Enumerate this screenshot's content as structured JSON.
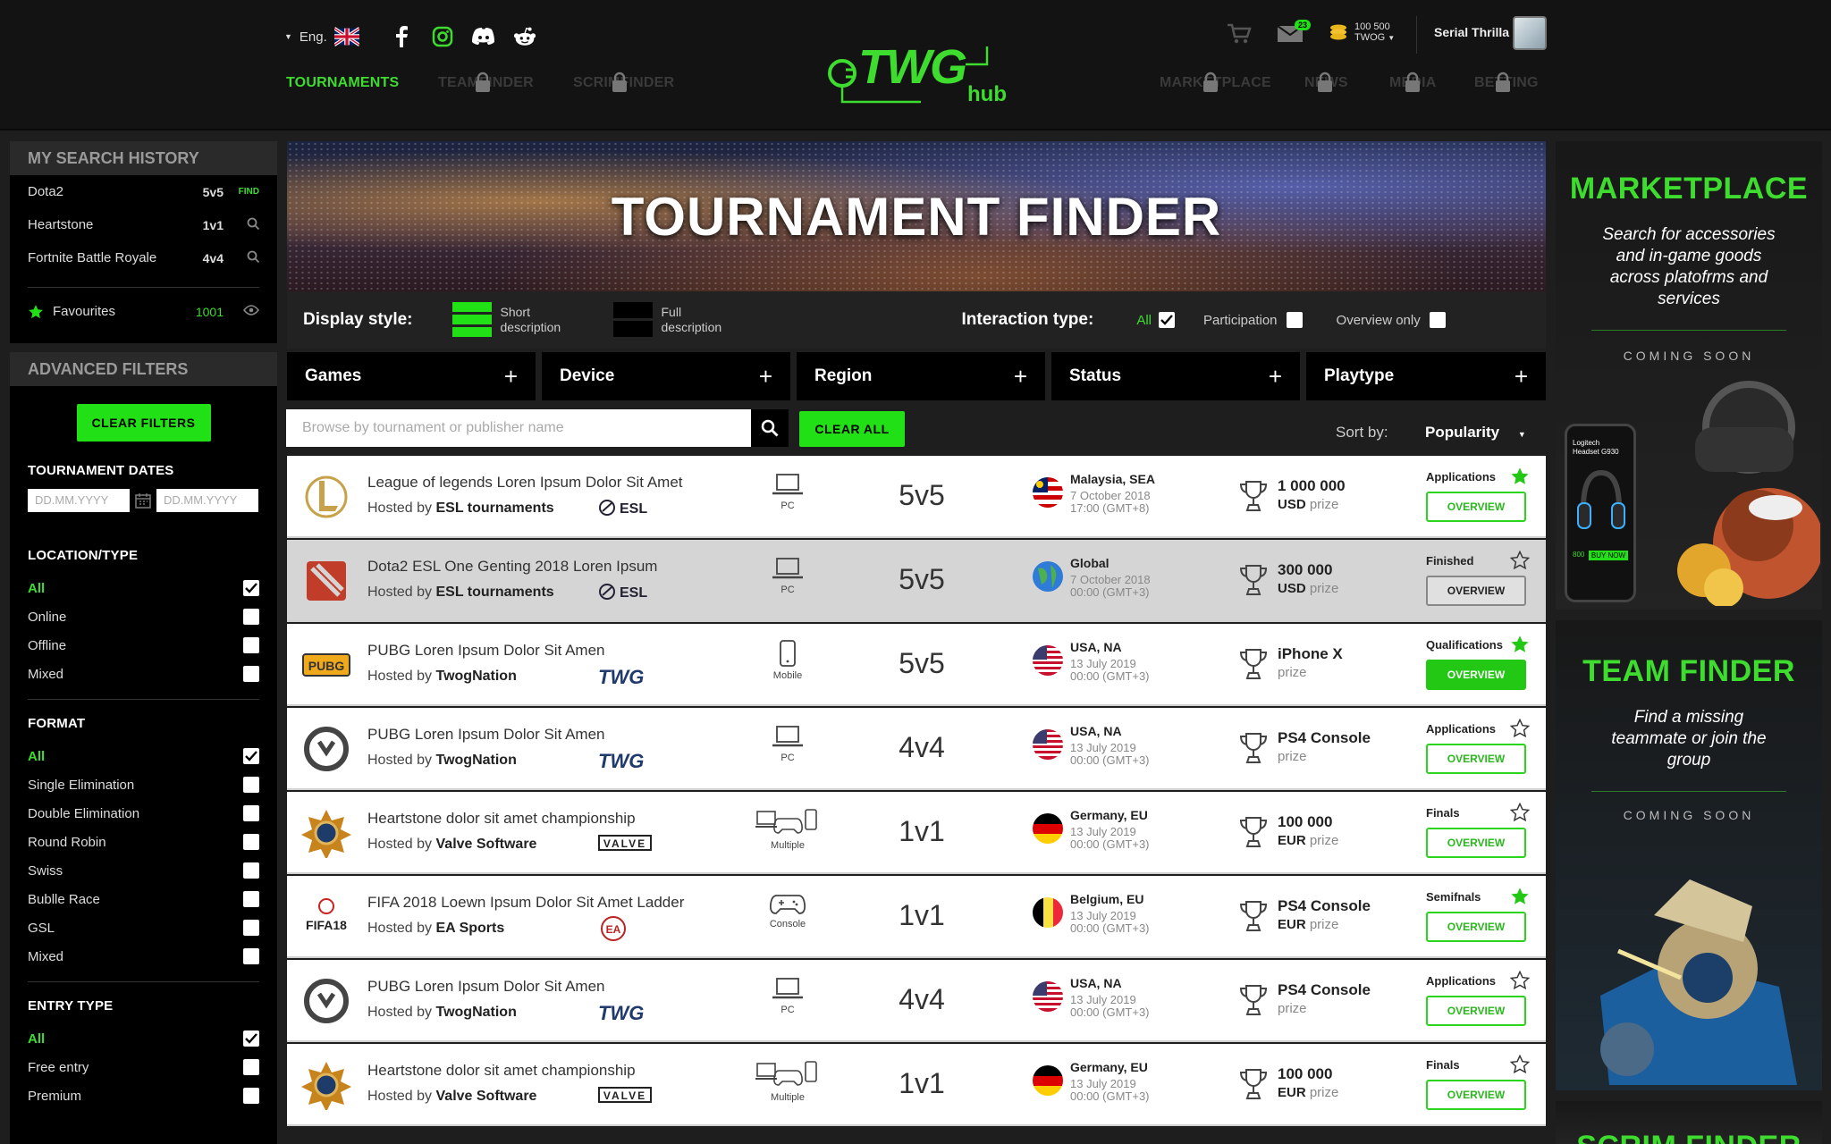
{
  "header": {
    "lang": "Eng.",
    "nav_left": [
      "TOURNAMENTS",
      "TEAMFINDER",
      "SCRIMFINDER"
    ],
    "nav_right": [
      "MARKETPLACE",
      "NEWS",
      "MEDIA",
      "BETTING"
    ],
    "logo_main": "TWG",
    "logo_sub": "hub",
    "msg_count": "23",
    "coins_amount": "100 500",
    "coins_unit": "TWOG",
    "username": "Serial Thrilla"
  },
  "history": {
    "title": "MY SEARCH HISTORY",
    "items": [
      {
        "name": "Dota2",
        "type": "5v5",
        "action": "FIND"
      },
      {
        "name": "Heartstone",
        "type": "1v1"
      },
      {
        "name": "Fortnite Battle Royale",
        "type": "4v4"
      }
    ],
    "fav_label": "Favourites",
    "fav_count": "1001"
  },
  "filters": {
    "title": "ADVANCED FILTERS",
    "clear": "CLEAR FILTERS",
    "dates_title": "TOURNAMENT DATES",
    "date_ph": "DD.MM.YYYY",
    "loc_title": "LOCATION/TYPE",
    "loc": [
      "All",
      "Online",
      "Offline",
      "Mixed"
    ],
    "format_title": "FORMAT",
    "format": [
      "All",
      "Single Elimination",
      "Double Elimination",
      "Round Robin",
      "Swiss",
      "Bublle Race",
      "GSL",
      "Mixed"
    ],
    "entry_title": "ENTRY TYPE",
    "entry": [
      "All",
      "Free entry",
      "Premium"
    ]
  },
  "banner_title": "TOURNAMENT FINDER",
  "display": {
    "label": "Display style:",
    "short": "Short description",
    "full": "Full description",
    "inter_label": "Interaction type:",
    "all": "All",
    "participation": "Participation",
    "overview": "Overview only"
  },
  "filterbar": [
    "Games",
    "Device",
    "Region",
    "Status",
    "Playtype"
  ],
  "search": {
    "placeholder": "Browse by tournament or publisher name",
    "clear_all": "CLEAR ALL",
    "sort_label": "Sort by:",
    "sort_value": "Popularity"
  },
  "hosted_by": "Hosted by",
  "rows": [
    {
      "title": "League of legends Loren Ipsum Dolor Sit Amet",
      "host": "ESL tournaments",
      "hlogo": "ESL",
      "device": "PC",
      "mode": "5v5",
      "region": "Malaysia, SEA",
      "date": "7 October 2018",
      "time": "17:00 (GMT+8)",
      "prize": "1 000 000",
      "unit": "USD",
      "status": "Applications",
      "btn": "OVERVIEW"
    },
    {
      "title": "Dota2 ESL One Genting 2018 Loren Ipsum",
      "host": "ESL tournaments",
      "hlogo": "ESL",
      "device": "PC",
      "mode": "5v5",
      "region": "Global",
      "date": "7 October 2018",
      "time": "00:00 (GMT+3)",
      "prize": "300 000",
      "unit": "USD",
      "status": "Finished",
      "btn": "OVERVIEW"
    },
    {
      "title": "PUBG Loren Ipsum Dolor Sit Amen",
      "host": "TwogNation",
      "hlogo": "TWG",
      "device": "Mobile",
      "mode": "5v5",
      "region": "USA, NA",
      "date": "13 July 2019",
      "time": "00:00 (GMT+3)",
      "prize": "iPhone X",
      "unit": "",
      "status": "Qualifications",
      "btn": "OVERVIEW"
    },
    {
      "title": "PUBG Loren Ipsum Dolor Sit Amen",
      "host": "TwogNation",
      "hlogo": "TWG",
      "device": "PC",
      "mode": "4v4",
      "region": "USA, NA",
      "date": "13 July 2019",
      "time": "00:00 (GMT+3)",
      "prize": "PS4 Console",
      "unit": "",
      "status": "Applications",
      "btn": "OVERVIEW"
    },
    {
      "title": "Heartstone dolor sit amet championship",
      "host": "Valve Software",
      "hlogo": "VALVE",
      "device": "Multiple",
      "mode": "1v1",
      "region": "Germany, EU",
      "date": "13 July 2019",
      "time": "00:00 (GMT+3)",
      "prize": "100 000",
      "unit": "EUR",
      "status": "Finals",
      "btn": "OVERVIEW"
    },
    {
      "title": "FIFA 2018 Loewn Ipsum Dolor Sit Amet Ladder",
      "host": "EA Sports",
      "hlogo": "EA",
      "device": "Console",
      "mode": "1v1",
      "region": "Belgium, EU",
      "date": "13 July 2019",
      "time": "00:00 (GMT+3)",
      "prize": "PS4 Console",
      "unit": "EUR",
      "status": "Semifnals",
      "btn": "OVERVIEW"
    },
    {
      "title": "PUBG Loren Ipsum Dolor Sit Amen",
      "host": "TwogNation",
      "hlogo": "TWG",
      "device": "PC",
      "mode": "4v4",
      "region": "USA, NA",
      "date": "13 July 2019",
      "time": "00:00 (GMT+3)",
      "prize": "PS4 Console",
      "unit": "",
      "status": "Applications",
      "btn": "OVERVIEW"
    },
    {
      "title": "Heartstone dolor sit amet championship",
      "host": "Valve Software",
      "hlogo": "VALVE",
      "device": "Multiple",
      "mode": "1v1",
      "region": "Germany, EU",
      "date": "13 July 2019",
      "time": "00:00 (GMT+3)",
      "prize": "100 000",
      "unit": "EUR",
      "status": "Finals",
      "btn": "OVERVIEW"
    }
  ],
  "prize_word": "prize",
  "ads": {
    "market_title": "MARKETPLACE",
    "market_text": "Search for accessories and in-game goods across platofrms and services",
    "soon": "COMING SOON",
    "team_title": "TEAM FINDER",
    "team_text": "Find a missing teammate or join the group",
    "scrim_title": "SCRIM FINDER",
    "phone_label": "Logitech Headset G930",
    "phone_price": "800",
    "phone_btn": "BUY NOW"
  },
  "colors": {
    "accent": "#22e016",
    "bg": "#1e1e1e"
  }
}
